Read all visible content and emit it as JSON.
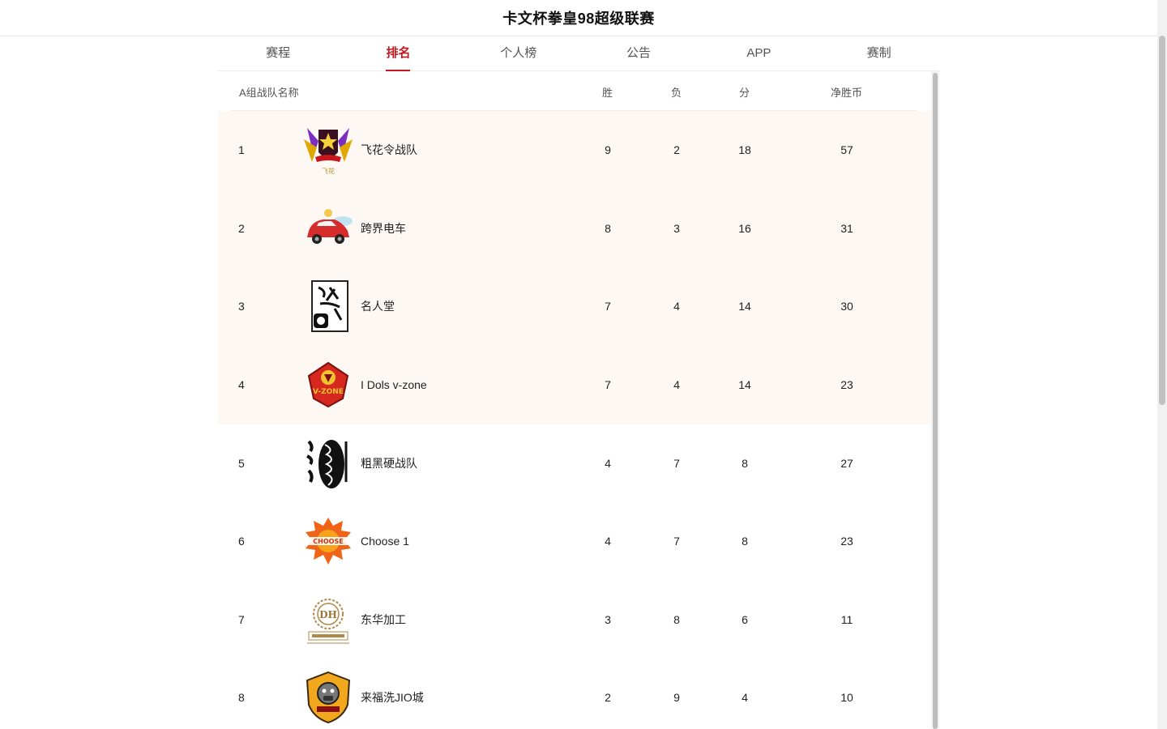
{
  "header": {
    "title": "卡文杯拳皇98超级联赛"
  },
  "tabs": [
    {
      "label": "赛程",
      "active": false
    },
    {
      "label": "排名",
      "active": true
    },
    {
      "label": "个人榜",
      "active": false
    },
    {
      "label": "公告",
      "active": false
    },
    {
      "label": "APP",
      "active": false
    },
    {
      "label": "赛制",
      "active": false
    }
  ],
  "table": {
    "headers": {
      "team": "A组战队名称",
      "win": "胜",
      "loss": "负",
      "points": "分",
      "net": "净胜币"
    },
    "rows": [
      {
        "rank": "1",
        "name": "飞花令战队",
        "win": "9",
        "loss": "2",
        "points": "18",
        "net": "57",
        "logo": "feihua-logo",
        "logo_text": "飞花"
      },
      {
        "rank": "2",
        "name": "跨界电车",
        "win": "8",
        "loss": "3",
        "points": "16",
        "net": "31",
        "logo": "red-car-logo"
      },
      {
        "rank": "3",
        "name": "名人堂",
        "win": "7",
        "loss": "4",
        "points": "14",
        "net": "30",
        "logo": "calligraphy-logo"
      },
      {
        "rank": "4",
        "name": "I Dols v-zone",
        "win": "7",
        "loss": "4",
        "points": "14",
        "net": "23",
        "logo": "vzone-logo",
        "logo_text": "V-ZONE"
      },
      {
        "rank": "5",
        "name": "粗黑硬战队",
        "win": "4",
        "loss": "7",
        "points": "8",
        "net": "27",
        "logo": "braid-logo"
      },
      {
        "rank": "6",
        "name": "Choose 1",
        "win": "4",
        "loss": "7",
        "points": "8",
        "net": "23",
        "logo": "choose-flame-logo",
        "logo_text": "CHOOSE"
      },
      {
        "rank": "7",
        "name": "东华加工",
        "win": "3",
        "loss": "8",
        "points": "6",
        "net": "11",
        "logo": "donghua-logo",
        "logo_text": "DH"
      },
      {
        "rank": "8",
        "name": "来福洗JIO城",
        "win": "2",
        "loss": "9",
        "points": "4",
        "net": "10",
        "logo": "bulldog-shield-logo"
      }
    ]
  },
  "colors": {
    "accent": "#c8161d",
    "highlight_row": "#fdf8f3"
  }
}
